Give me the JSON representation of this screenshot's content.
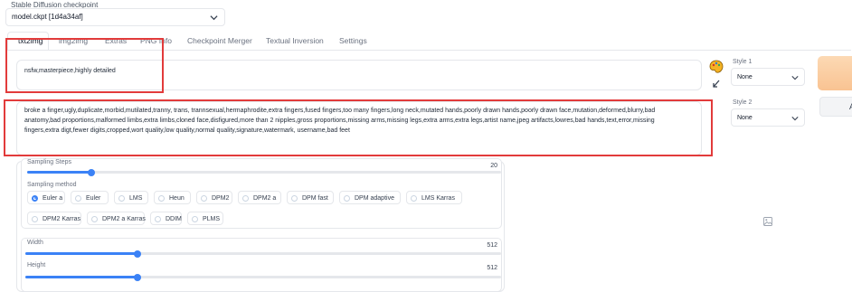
{
  "checkpoint": {
    "label": "Stable Diffusion checkpoint",
    "value": "model.ckpt [1d4a34af]"
  },
  "tabs": [
    {
      "label": "txt2img",
      "active": true
    },
    {
      "label": "img2img",
      "active": false
    },
    {
      "label": "Extras",
      "active": false
    },
    {
      "label": "PNG Info",
      "active": false
    },
    {
      "label": "Checkpoint Merger",
      "active": false
    },
    {
      "label": "Textual Inversion",
      "active": false
    },
    {
      "label": "Settings",
      "active": false
    }
  ],
  "prompt": {
    "value": "nsfw,masterpiece,highly detailed"
  },
  "negative_prompt": {
    "line1": "broke a finger,ugly,duplicate,morbid,mutilated,tranny, trans, trannsexual,hermaphrodite,extra fingers,fused fingers,too many fingers,long neck,mutated hands,poorly drawn hands,poorly drawn face,mutation,deformed,blurry,bad",
    "line2": "anatomy,bad proportions,malformed limbs,extra limbs,cloned face,disfigured,more than 2 nipples,gross proportions,missing arms,missing legs,extra arms,extra legs,artist name,jpeg artifacts,lowres,bad hands,text,error,missing",
    "line3": "fingers,extra digt,fewer digits,cropped,wort quality,low quality,normal quality,signature,watermark, username,bad feet"
  },
  "styles": {
    "style1_label": "Style 1",
    "style1_value": "None",
    "style2_label": "Style 2",
    "style2_value": "None"
  },
  "generate_small_btn_text": "A",
  "sampling_steps": {
    "label": "Sampling Steps",
    "value": "20",
    "fraction": 0.135
  },
  "sampling_method": {
    "label": "Sampling method",
    "options": [
      {
        "label": "Euler a",
        "checked": true
      },
      {
        "label": "Euler",
        "checked": false
      },
      {
        "label": "LMS",
        "checked": false
      },
      {
        "label": "Heun",
        "checked": false
      },
      {
        "label": "DPM2",
        "checked": false
      },
      {
        "label": "DPM2 a",
        "checked": false
      },
      {
        "label": "DPM fast",
        "checked": false
      },
      {
        "label": "DPM adaptive",
        "checked": false
      },
      {
        "label": "LMS Karras",
        "checked": false
      },
      {
        "label": "DPM2 Karras",
        "checked": false
      },
      {
        "label": "DPM2 a Karras",
        "checked": false
      },
      {
        "label": "DDIM",
        "checked": false
      },
      {
        "label": "PLMS",
        "checked": false
      }
    ]
  },
  "width": {
    "label": "Width",
    "value": "512",
    "fraction": 0.235
  },
  "height": {
    "label": "Height",
    "value": "512",
    "fraction": 0.235
  },
  "colors": {
    "accent": "#3b82f6",
    "highlight": "#e23b3b"
  },
  "icons": [
    "chevron-down-icon",
    "paint-palette-icon",
    "arrow-icon",
    "image-placeholder-icon"
  ]
}
